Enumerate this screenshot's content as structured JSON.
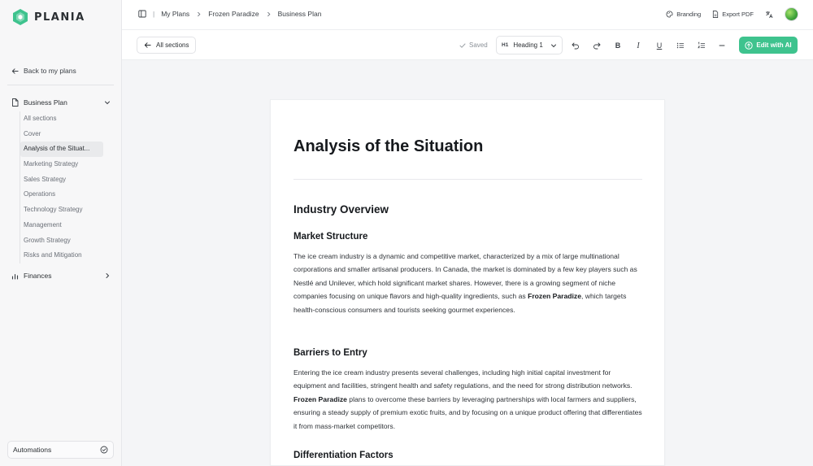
{
  "app": {
    "name": "PLANIA",
    "brand_color": "#3ec38e"
  },
  "sidebar": {
    "back_label": "Back to my plans",
    "business_plan": {
      "label": "Business Plan",
      "items": [
        "All sections",
        "Cover",
        "Analysis of the Situat...",
        "Marketing Strategy",
        "Sales Strategy",
        "Operations",
        "Technology Strategy",
        "Management",
        "Growth Strategy",
        "Risks and Mitigation"
      ],
      "active_index": 2
    },
    "finances_label": "Finances",
    "automations_label": "Automations"
  },
  "header": {
    "breadcrumb": [
      "My Plans",
      "Frozen Paradize",
      "Business Plan"
    ],
    "branding_label": "Branding",
    "export_label": "Export PDF"
  },
  "toolbar": {
    "all_sections_label": "All sections",
    "saved_label": "Saved",
    "heading_tag": "H1",
    "heading_value": "Heading 1",
    "edit_ai_label": "Edit with AI"
  },
  "document": {
    "title": "Analysis of the Situation",
    "section_heading": "Industry Overview",
    "sub1": "Market Structure",
    "p1_a": "The ice cream industry is a dynamic and competitive market, characterized by a mix of large multinational corporations and smaller artisanal producers. In Canada, the market is dominated by a few key players such as Nestlé and Unilever, which hold significant market shares. However, there is a growing segment of niche companies focusing on unique flavors and high-quality ingredients, such as ",
    "p1_bold": "Frozen Paradize",
    "p1_b": ", which targets health-conscious consumers and tourists seeking gourmet experiences.",
    "sub2": "Barriers to Entry",
    "p2_a": "Entering the ice cream industry presents several challenges, including high initial capital investment for equipment and facilities, stringent health and safety regulations, and the need for strong distribution networks. ",
    "p2_bold": "Frozen Paradize",
    "p2_b": " plans to overcome these barriers by leveraging partnerships with local farmers and suppliers, ensuring a steady supply of premium exotic fruits, and by focusing on a unique product offering that differentiates it from mass-market competitors.",
    "sub3": "Differentiation Factors"
  }
}
